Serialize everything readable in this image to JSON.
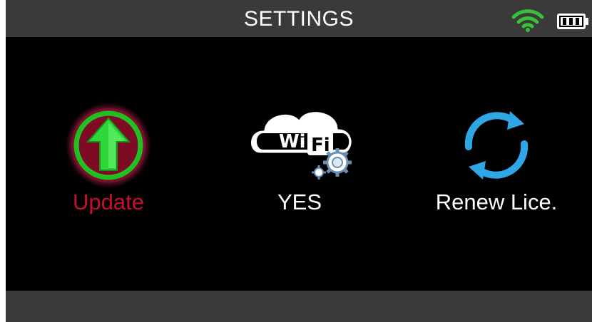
{
  "header": {
    "title": "SETTINGS",
    "wifi_icon": "wifi-signal-icon",
    "battery_icon": "battery-icon"
  },
  "tiles": [
    {
      "id": "update",
      "label": "Update",
      "icon": "update-arrow-icon",
      "label_color": "#c8102e"
    },
    {
      "id": "wifi",
      "label": "YES",
      "icon": "wifi-settings-icon",
      "icon_text": "Wi Fi"
    },
    {
      "id": "renew",
      "label": "Renew Lice.",
      "icon": "renew-refresh-icon"
    }
  ],
  "colors": {
    "header_bg": "#3a3a3a",
    "screen_bg": "#000000",
    "accent_green": "#3bd33b",
    "accent_red": "#c8102e",
    "accent_blue": "#2fa6e6"
  }
}
